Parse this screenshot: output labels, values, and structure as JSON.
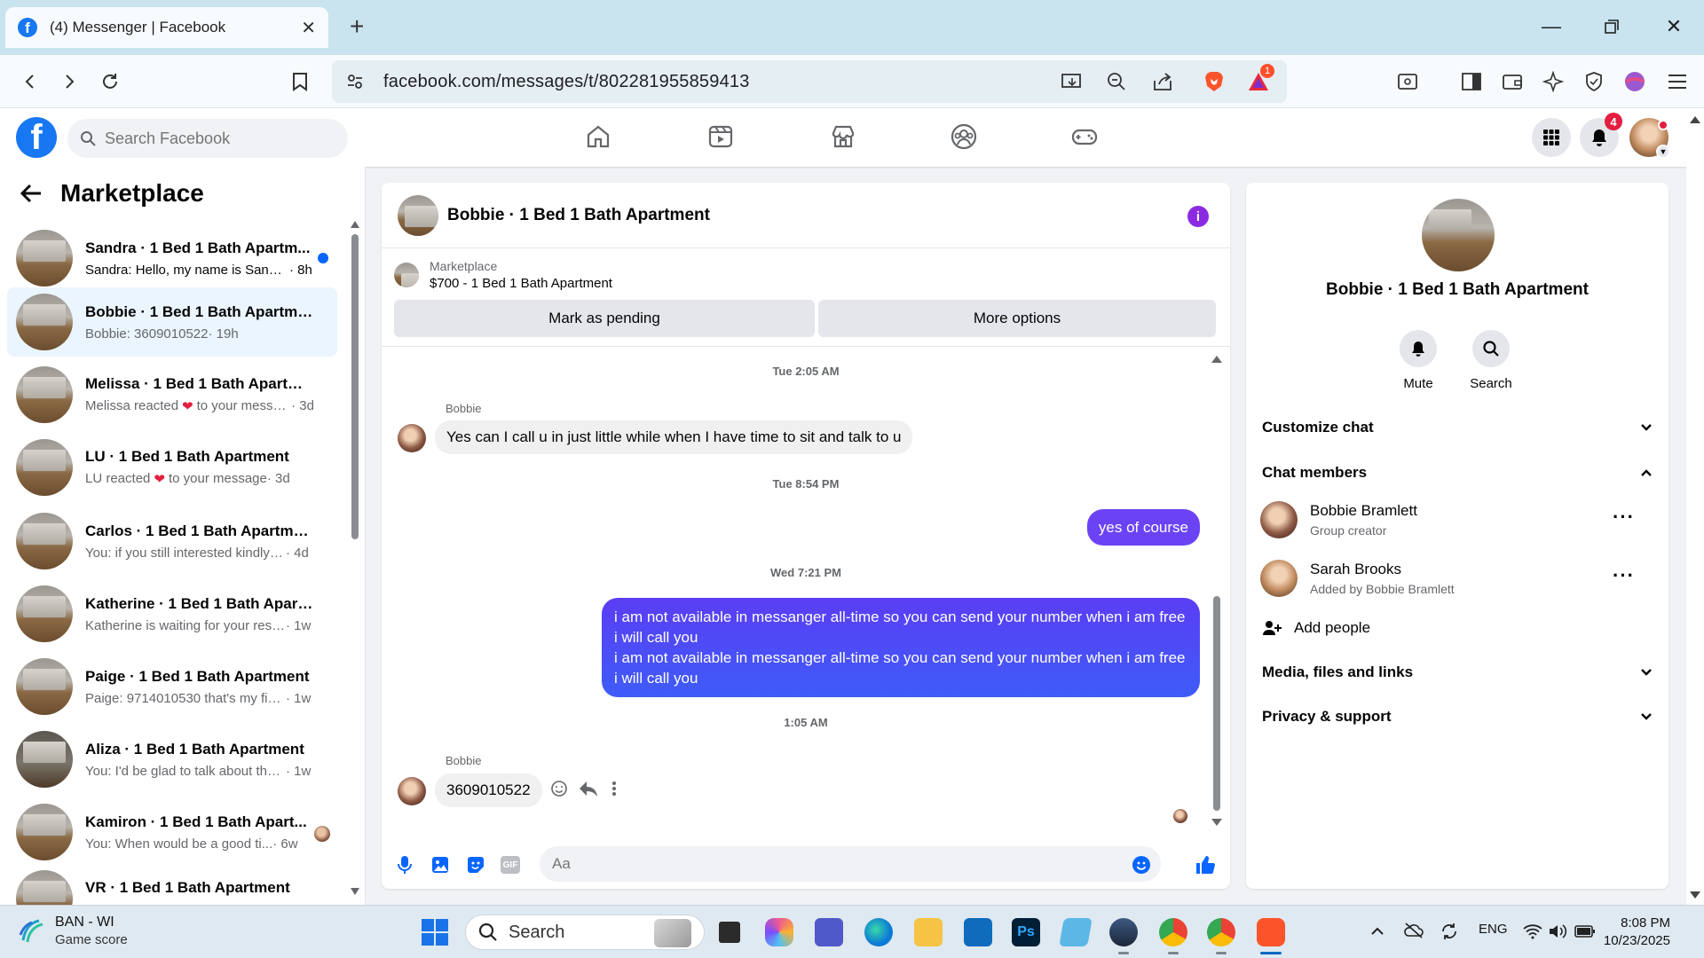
{
  "browser": {
    "tab_title": "(4) Messenger | Facebook",
    "url": "facebook.com/messages/t/802281955859413",
    "extension_badge": "1"
  },
  "fbnav": {
    "search_placeholder": "Search Facebook",
    "notification_count": "4"
  },
  "left": {
    "title": "Marketplace",
    "conversations": [
      {
        "name": "Sandra · 1 Bed 1 Bath Apartm...",
        "snippet": "Sandra: Hello, my name is Sand...",
        "time": "· 8h",
        "unread": true
      },
      {
        "name": "Bobbie · 1 Bed 1 Bath Apartment",
        "snippet": "Bobbie: 3609010522",
        "time": "· 19h",
        "active": true
      },
      {
        "name": "Melissa · 1 Bed 1 Bath Apartment",
        "snippet_pre": "Melissa reacted",
        "snippet": "to your messa...",
        "time": "· 3d"
      },
      {
        "name": "LU · 1 Bed 1 Bath Apartment",
        "snippet_pre": "LU reacted",
        "snippet": "to your message",
        "time": "· 3d"
      },
      {
        "name": "Carlos · 1 Bed 1 Bath Apartment",
        "snippet": "You: if you still interested kindly se...",
        "time": "· 4d"
      },
      {
        "name": "Katherine · 1 Bed 1 Bath Apartm...",
        "snippet": "Katherine is waiting for your resp...",
        "time": "· 1w"
      },
      {
        "name": "Paige · 1 Bed 1 Bath Apartment",
        "snippet": "Paige: 9714010530 that's my fianc...",
        "time": "· 1w"
      },
      {
        "name": "Aliza · 1 Bed 1 Bath Apartment",
        "snippet": "You: I'd be glad to talk about the ...",
        "time": "· 1w"
      },
      {
        "name": "Kamiron · 1 Bed 1 Bath Apart...",
        "snippet": "You: When would be a good ti...",
        "time": "· 6w"
      },
      {
        "name": "VR · 1 Bed 1 Bath Apartment",
        "snippet": "",
        "time": ""
      }
    ]
  },
  "chat": {
    "title": "Bobbie · 1 Bed 1 Bath Apartment",
    "marketplace_label": "Marketplace",
    "listing": "$700 - 1 Bed 1 Bath Apartment",
    "mark_pending": "Mark as pending",
    "more_options": "More options",
    "messages": {
      "ts1": "Tue 2:05 AM",
      "sender1": "Bobbie",
      "msg1": "Yes can I call u in just little while when I have time to sit and talk to u",
      "ts2": "Tue 8:54 PM",
      "msg2": "yes of course",
      "ts3": "Wed 7:21 PM",
      "msg3a": "i am not available in messanger all-time so you can send your number when i am free i will call you",
      "msg3b": "i am not available in messanger all-time so you can send your number when i am free i will call you",
      "ts4": "1:05 AM",
      "sender4": "Bobbie",
      "msg4": "3609010522"
    },
    "input_placeholder": "Aa"
  },
  "right": {
    "name": "Bobbie · 1 Bed 1 Bath Apartment",
    "mute": "Mute",
    "search": "Search",
    "customize": "Customize chat",
    "members_title": "Chat members",
    "members": [
      {
        "name": "Bobbie Bramlett",
        "role": "Group creator"
      },
      {
        "name": "Sarah Brooks",
        "role": "Added by Bobbie Bramlett"
      }
    ],
    "add_people": "Add people",
    "media": "Media, files and links",
    "privacy": "Privacy & support"
  },
  "taskbar": {
    "weather_l1": "BAN - WI",
    "weather_l2": "Game score",
    "search": "Search",
    "lang": "ENG",
    "time": "8:08 PM",
    "date": "10/23/2025"
  }
}
